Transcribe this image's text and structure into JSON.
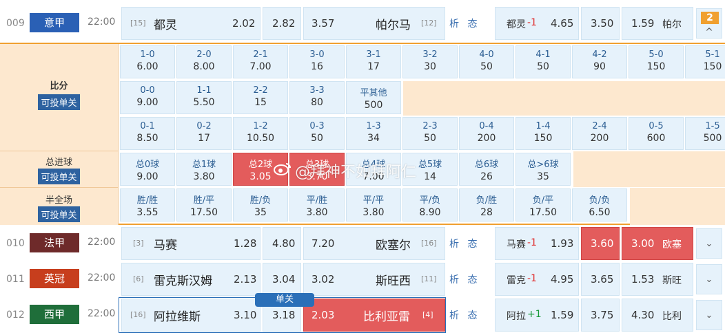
{
  "matches": [
    {
      "id": "009",
      "league": "意甲",
      "league_color": "#2a60b5",
      "time": "22:00",
      "home_rank": "[15]",
      "home": "都灵",
      "o1": "2.02",
      "o2": "2.82",
      "o3": "3.57",
      "away": "帕尔马",
      "away_rank": "[12]",
      "analysis": "析 态",
      "h_team": "都灵",
      "h_val": "-1",
      "r1": "4.65",
      "r2": "3.50",
      "r3": "1.59",
      "r_away": "帕尔",
      "badge": "2",
      "toggle": "^"
    },
    {
      "id": "010",
      "league": "法甲",
      "league_color": "#6e2a2a",
      "time": "22:00",
      "home_rank": "[3]",
      "home": "马赛",
      "o1": "1.28",
      "o2": "4.80",
      "o3": "7.20",
      "away": "欧塞尔",
      "away_rank": "[16]",
      "analysis": "析 态",
      "h_team": "马赛",
      "h_val": "-1",
      "r1": "1.93",
      "r2": "3.60",
      "r3": "3.00",
      "r_away": "欧塞",
      "toggle": "⌄"
    },
    {
      "id": "011",
      "league": "英冠",
      "league_color": "#c73e1d",
      "time": "22:00",
      "home_rank": "[6]",
      "home": "雷克斯汉姆",
      "o1": "2.13",
      "o2": "3.04",
      "o3": "3.02",
      "away": "斯旺西",
      "away_rank": "[11]",
      "analysis": "析 态",
      "h_team": "雷克",
      "h_val": "-1",
      "r1": "4.95",
      "r2": "3.65",
      "r3": "1.53",
      "r_away": "斯旺",
      "toggle": "⌄"
    },
    {
      "id": "012",
      "league": "西甲",
      "league_color": "#1f6e3a",
      "time": "22:00",
      "home_rank": "[16]",
      "home": "阿拉维斯",
      "o1": "3.10",
      "o2": "3.18",
      "o3": "2.03",
      "away": "比利亚雷",
      "away_rank": "[4]",
      "analysis": "析 态",
      "h_team": "阿拉",
      "h_val": "+1",
      "r1": "1.59",
      "r2": "3.75",
      "r3": "4.30",
      "r_away": "比利",
      "toggle": "⌄",
      "single_tag": "单关"
    }
  ],
  "panel": {
    "score_label": "比分",
    "single_label": "可投单关",
    "goals_label": "总进球",
    "half_label": "半全场",
    "score_row1": [
      [
        "1-0",
        "6.00"
      ],
      [
        "2-0",
        "8.00"
      ],
      [
        "2-1",
        "7.00"
      ],
      [
        "3-0",
        "16"
      ],
      [
        "3-1",
        "17"
      ],
      [
        "3-2",
        "30"
      ],
      [
        "4-0",
        "50"
      ],
      [
        "4-1",
        "50"
      ],
      [
        "4-2",
        "90"
      ],
      [
        "5-0",
        "150"
      ],
      [
        "5-1",
        "150"
      ]
    ],
    "score_row2": [
      [
        "0-0",
        "9.00"
      ],
      [
        "1-1",
        "5.50"
      ],
      [
        "2-2",
        "15"
      ],
      [
        "3-3",
        "80"
      ],
      [
        "平其他",
        "500"
      ]
    ],
    "score_row3": [
      [
        "0-1",
        "8.50"
      ],
      [
        "0-2",
        "17"
      ],
      [
        "1-2",
        "10.50"
      ],
      [
        "0-3",
        "50"
      ],
      [
        "1-3",
        "34"
      ],
      [
        "2-3",
        "50"
      ],
      [
        "0-4",
        "200"
      ],
      [
        "1-4",
        "150"
      ],
      [
        "2-4",
        "200"
      ],
      [
        "0-5",
        "600"
      ],
      [
        "1-5",
        "500"
      ]
    ],
    "goals": [
      [
        "总0球",
        "9.00"
      ],
      [
        "总1球",
        "3.80"
      ],
      [
        "总2球",
        "3.05"
      ],
      [
        "总3球",
        "3.70"
      ],
      [
        "总4球",
        "7.00"
      ],
      [
        "总5球",
        "14"
      ],
      [
        "总6球",
        "26"
      ],
      [
        "总>6球",
        "35"
      ]
    ],
    "halfs": [
      [
        "胜/胜",
        "3.55"
      ],
      [
        "胜/平",
        "17.50"
      ],
      [
        "胜/负",
        "35"
      ],
      [
        "平/胜",
        "3.80"
      ],
      [
        "平/平",
        "3.80"
      ],
      [
        "平/负",
        "8.90"
      ],
      [
        "负/胜",
        "28"
      ],
      [
        "负/平",
        "17.50"
      ],
      [
        "负/负",
        "6.50"
      ]
    ]
  },
  "watermark": "@拜神不如拜阿仁",
  "colors": {
    "hot": "#e35c5c",
    "accent": "#f0a030",
    "cell": "#e6f2fb"
  }
}
